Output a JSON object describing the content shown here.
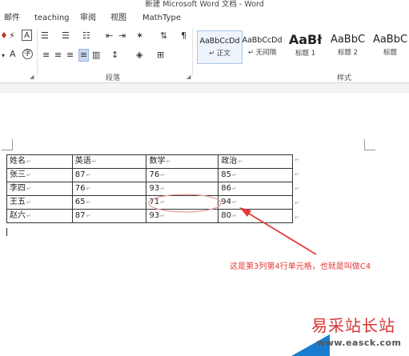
{
  "window": {
    "title": "新建 Microsoft Word 文档 - Word"
  },
  "tabs": [
    "邮件",
    "teaching",
    "审阅",
    "视图",
    "MathType"
  ],
  "ribbon": {
    "paragraph_label": "段落",
    "styles_label": "样式",
    "styles": [
      {
        "sample": "AaBbCcDd",
        "name": "↵ 正文"
      },
      {
        "sample": "AaBbCcDd",
        "name": "↵ 无间隔"
      },
      {
        "sample": "AaBł",
        "name": "标题 1"
      },
      {
        "sample": "AaBbC",
        "name": "标题 2"
      },
      {
        "sample": "AaBbC",
        "name": "标题"
      }
    ]
  },
  "table": {
    "header": [
      "姓名",
      "英语",
      "数学",
      "政治"
    ],
    "rows": [
      [
        "张三",
        "87",
        "76",
        "85"
      ],
      [
        "李四",
        "76",
        "93",
        "86"
      ],
      [
        "王五",
        "65",
        "71",
        "94"
      ],
      [
        "赵六",
        "87",
        "93",
        "80"
      ]
    ]
  },
  "annotation": {
    "text": "这是第3列第4行单元格，也就是叫做C4",
    "color": "#e33a3a"
  },
  "watermark": {
    "text": "易采站长站",
    "subtext": "www.easck.com"
  },
  "colors": {
    "annotation_red": "#e33a3a",
    "selected_style_border": "#a9c5e8",
    "watermark_blue": "#1a7ccf"
  }
}
